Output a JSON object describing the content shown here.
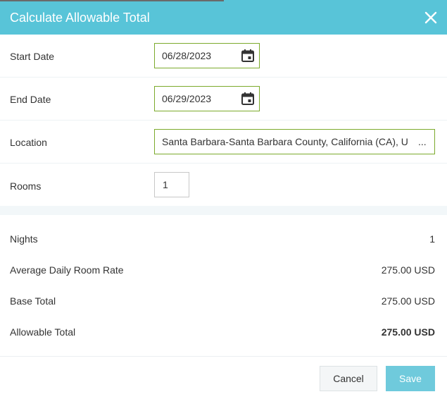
{
  "dialog": {
    "title": "Calculate Allowable Total",
    "close_icon": "close-icon"
  },
  "form": {
    "start_date": {
      "label": "Start Date",
      "value": "06/28/2023",
      "icon": "calendar-icon"
    },
    "end_date": {
      "label": "End Date",
      "value": "06/29/2023",
      "icon": "calendar-icon"
    },
    "location": {
      "label": "Location",
      "value": "Santa Barbara-Santa Barbara County, California (CA), U",
      "overflow": "..."
    },
    "rooms": {
      "label": "Rooms",
      "value": "1"
    }
  },
  "summary": {
    "nights": {
      "label": "Nights",
      "value": "1"
    },
    "avg_rate": {
      "label": "Average Daily Room Rate",
      "value": "275.00 USD"
    },
    "base_total": {
      "label": "Base Total",
      "value": "275.00 USD"
    },
    "allowable_total": {
      "label": "Allowable Total",
      "value": "275.00 USD"
    }
  },
  "footer": {
    "cancel_label": "Cancel",
    "save_label": "Save"
  },
  "colors": {
    "header": "#58c4d8",
    "input_border_active": "#7caa2c",
    "save_button": "#6fcadc"
  }
}
